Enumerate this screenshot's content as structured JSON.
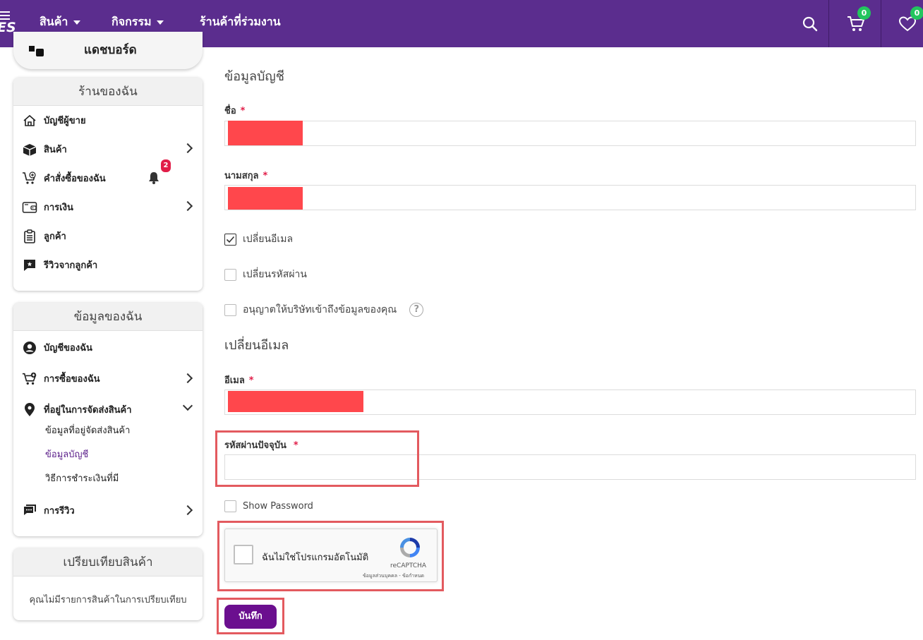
{
  "colors": {
    "brand": "#5b2d8e",
    "badge": "#22c55e",
    "alert": "#e11d48",
    "highlight": "#e35a5f",
    "button": "#6b0f8f"
  },
  "header": {
    "logo_text": "ES",
    "nav": [
      {
        "label": "สินค้า",
        "has_caret": true
      },
      {
        "label": "กิจกรรม",
        "has_caret": true
      },
      {
        "label": "ร้านค้าที่ร่วมงาน",
        "has_caret": false
      }
    ],
    "cart_count": "0",
    "wishlist_count": "0"
  },
  "sidebar": {
    "top_card_text": "แดชบอร์ด",
    "my_shop": {
      "title": "ร้านของฉัน",
      "items": [
        {
          "label": "บัญชีผู้ขาย",
          "icon": "home-icon"
        },
        {
          "label": "สินค้า",
          "icon": "box-icon"
        },
        {
          "label": "คำสั่งซื้อของฉัน",
          "icon": "cart-plus-icon",
          "notification_count": "2"
        },
        {
          "label": "การเงิน",
          "icon": "wallet-icon"
        },
        {
          "label": "ลูกค้า",
          "icon": "clipboard-icon"
        },
        {
          "label": "รีวิวจากลูกค้า",
          "icon": "review-icon"
        }
      ]
    },
    "my_info": {
      "title": "ข้อมูลของฉัน",
      "items": [
        {
          "label": "บัญชีของฉัน",
          "icon": "user-circle-icon"
        },
        {
          "label": "การซื้อของฉัน",
          "icon": "cart-icon"
        },
        {
          "label": "ที่อยู่ในการจัดส่งสินค้า",
          "icon": "location-icon"
        },
        {
          "label": "การรีวิว",
          "icon": "chat-icon"
        }
      ],
      "subitems": [
        "ข้อมูลที่อยู่จัดส่งสินค้า",
        "ข้อมูลบัญชี",
        "วิธีการชำระเงินที่มี"
      ]
    },
    "compare": {
      "title": "เปรียบเทียบสินค้า",
      "empty_text": "คุณไม่มีรายการสินค้าในการเปรียบเทียบ"
    }
  },
  "form": {
    "section_title": "ข้อมูลบัญชี",
    "first_name_label": "ชื่อ",
    "last_name_label": "นามสกุล",
    "required_mark": "*",
    "change_email_label": "เปลี่ยนอีเมล",
    "change_email_checked": true,
    "change_password_label": "เปลี่ยนรหัสผ่าน",
    "change_password_checked": false,
    "allow_access_label": "อนุญาตให้บริษัทเข้าถึงข้อมูลของคุณ",
    "allow_access_checked": false,
    "email_section_title": "เปลี่ยนอีเมล",
    "email_label": "อีเมล",
    "current_password_label": "รหัสผ่านปัจจุบัน",
    "current_password_value": "",
    "show_password_label": "Show Password",
    "save_label": "บันทึก"
  },
  "recaptcha": {
    "label": "ฉันไม่ใช่โปรแกรมอัตโนมัติ",
    "brand": "reCAPTCHA",
    "footer": "ข้อมูลส่วนบุคคล - ข้อกำหนด"
  }
}
